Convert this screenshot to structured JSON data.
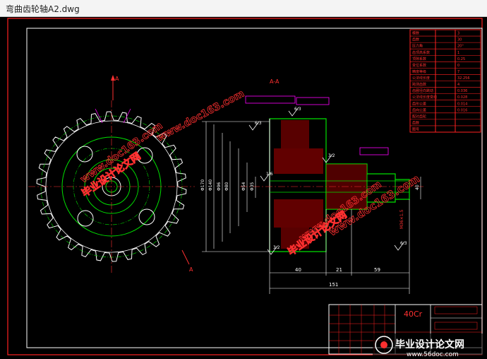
{
  "window": {
    "title": "弯曲齿轮轴A2.dwg"
  },
  "drawing": {
    "section_label": "A-A",
    "view_marker": "A",
    "material": "40Cr",
    "watermarks": [
      "www.doc163.com",
      "毕业设计论文网"
    ],
    "corner_logo": {
      "text": "毕业设计论文网",
      "url": "www.56doc.com"
    },
    "dimensions": {
      "overall_length": "151",
      "seg1": "40",
      "seg2": "21",
      "seg3": "59",
      "dia_outer": "Φ170",
      "dia_mid1": "Φ140",
      "dia_mid2": "Φ96",
      "dia_mid3": "Φ80",
      "dia_shaft1": "Φ54",
      "dia_shaft2": "Φ35",
      "dia_end": "40",
      "keyway": "M36×1.5"
    },
    "roughness": [
      "6.3",
      "6.3",
      "3.2",
      "1.6",
      "3.2",
      "6.3"
    ],
    "param_table": {
      "rows": [
        "模数",
        "齿数",
        "压力角",
        "齿顶高系数",
        "顶隙系数",
        "变位系数",
        "精度等级",
        "公法线长度",
        "跨测齿数",
        "齿圈径向跳动",
        "公法线长度变动",
        "齿形公差",
        "齿向公差",
        "配对齿轮",
        "齿数",
        "图号"
      ],
      "values": [
        "3",
        "30",
        "20°",
        "1",
        "0.25",
        "0",
        "7",
        "32.256",
        "4",
        "0.036",
        "0.028",
        "0.014",
        "0.016",
        "",
        "",
        ""
      ]
    }
  }
}
